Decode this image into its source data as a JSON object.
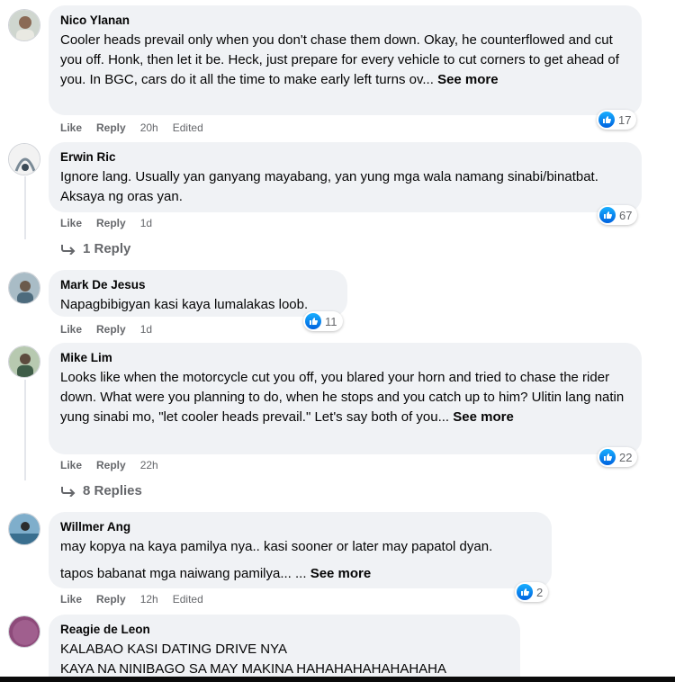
{
  "comments": [
    {
      "author": "Nico Ylanan",
      "text": "Cooler heads prevail only when you don't chase them down. Okay, he counterflowed and cut you off. Honk, then let it be. Heck, just prepare for every vehicle to cut corners to get ahead of you. In BGC, cars do it all the time to make early left turns ov...",
      "see_more": "See more",
      "like": "Like",
      "reply": "Reply",
      "time": "20h",
      "edited": "Edited",
      "reactions": "17"
    },
    {
      "author": "Erwin Ric",
      "text": "Ignore lang. Usually yan ganyang mayabang, yan yung mga wala namang sinabi/binatbat. Aksaya ng oras yan.",
      "like": "Like",
      "reply": "Reply",
      "time": "1d",
      "reactions": "67",
      "replies": "1 Reply"
    },
    {
      "author": "Mark De Jesus",
      "text": "Napagbibigyan kasi kaya lumalakas loob.",
      "like": "Like",
      "reply": "Reply",
      "time": "1d",
      "reactions": "11"
    },
    {
      "author": "Mike Lim",
      "text": "Looks like when the motorcycle cut you off, you blared your horn and tried to chase the rider down. What were you planning to do, when he stops and you catch up to him? Ulitin lang natin yung sinabi mo, \"let cooler heads prevail.\" Let's say both of you...",
      "see_more": "See more",
      "like": "Like",
      "reply": "Reply",
      "time": "22h",
      "reactions": "22",
      "replies": "8 Replies"
    },
    {
      "author": "Willmer Ang",
      "text": "may kopya na kaya pamilya nya.. kasi sooner or later may papatol dyan.",
      "text2": "tapos babanat mga naiwang pamilya... ...",
      "see_more": "See more",
      "like": "Like",
      "reply": "Reply",
      "time": "12h",
      "edited": "Edited",
      "reactions": "2"
    },
    {
      "author": "Reagie de Leon",
      "text": "KALABAO KASI DATING DRIVE NYA",
      "text2": "KAYA NA NINIBAGO SA MAY MAKINA HAHAHAHAHAHAHAHA"
    }
  ],
  "colors": {
    "bubble": "#f0f2f5",
    "meta": "#65676b",
    "like_blue": "#0866ff"
  }
}
